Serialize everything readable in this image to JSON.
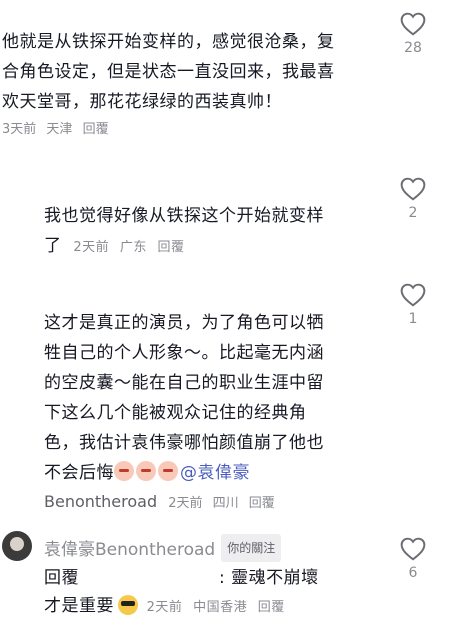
{
  "comments": [
    {
      "text_lines": [
        "他就是从铁探开始变样的，感觉很沧桑，复",
        "合角色设定，但是状态一直没回来，我最喜",
        "欢天堂哥，那花花绿绿的西装真帅！"
      ],
      "time": "3天前",
      "location": "天津",
      "reply_label": "回覆",
      "likes": "28"
    },
    {
      "text_lines": [
        "我也觉得好像从铁探这个开始就变样",
        "了"
      ],
      "time": "2天前",
      "location": "广东",
      "reply_label": "回覆",
      "likes": "2"
    },
    {
      "text_lines": [
        "这才是真正的演员，为了角色可以牺",
        "牲自己的个人形象～。比起毫无内涵",
        "的空皮囊～能在自己的职业生涯中留",
        "下这么几个能被观众记住的经典角",
        "色，我估计袁伟豪哪怕颜值崩了他也"
      ],
      "last_line_text": "不会后悔",
      "mention": "@袁偉豪",
      "author": "Benontheroad",
      "time": "2天前",
      "location": "四川",
      "reply_label": "回覆",
      "likes": "1"
    },
    {
      "author": "袁偉豪",
      "reply_to": "Benontheroad",
      "tag": "你的關注",
      "reply_prefix": "回覆",
      "text_tail": ": 靈魂不崩壞",
      "text_line2": "才是重要",
      "time": "2天前",
      "location": "中国香港",
      "reply_label": "回覆",
      "likes": "6"
    }
  ],
  "icons": {
    "like": "heart-outline-icon",
    "emoji": "pig-face-emoji",
    "sunglasses": "sunglasses-emoji"
  }
}
